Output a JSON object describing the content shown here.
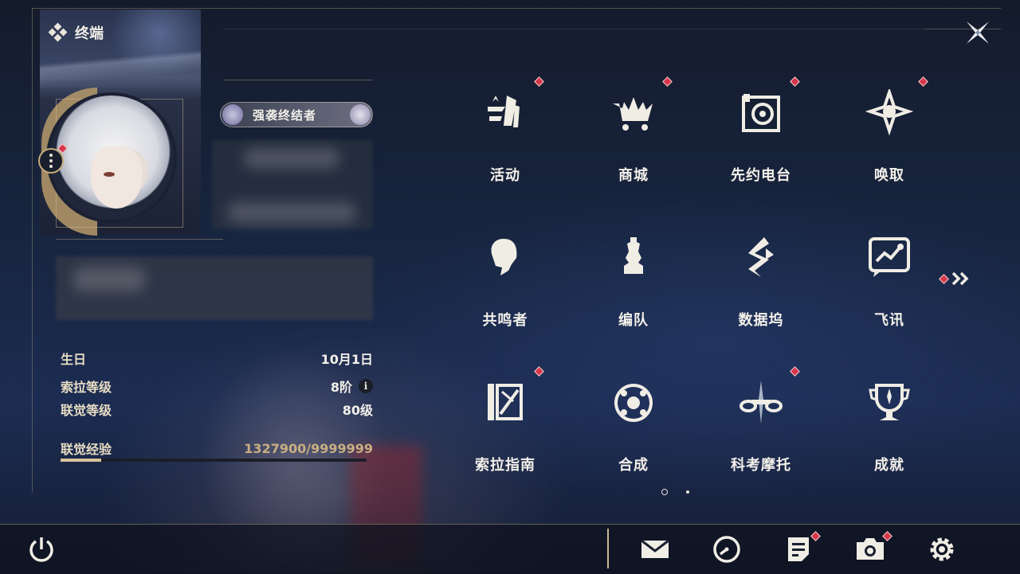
{
  "header": {
    "title": "终端"
  },
  "profile": {
    "title_badge": "强袭终结者",
    "stats": [
      {
        "label": "生日",
        "value": "10月1日"
      },
      {
        "label": "索拉等级",
        "value": "8阶"
      },
      {
        "label": "联觉等级",
        "value": "80级"
      }
    ],
    "exp": {
      "label": "联觉经验",
      "value": "1327900/9999999",
      "progress": 0.1328
    }
  },
  "menu": {
    "items": [
      {
        "label": "活动",
        "icon": "activity-icon",
        "badge": true
      },
      {
        "label": "商城",
        "icon": "shop-icon",
        "badge": true
      },
      {
        "label": "先约电台",
        "icon": "radio-icon",
        "badge": true
      },
      {
        "label": "唤取",
        "icon": "summon-icon",
        "badge": true
      },
      {
        "label": "共鸣者",
        "icon": "resonator-icon",
        "badge": false
      },
      {
        "label": "编队",
        "icon": "team-icon",
        "badge": false
      },
      {
        "label": "数据坞",
        "icon": "data-dock-icon",
        "badge": false
      },
      {
        "label": "飞讯",
        "icon": "message-icon",
        "badge": false
      },
      {
        "label": "索拉指南",
        "icon": "guide-icon",
        "badge": true
      },
      {
        "label": "合成",
        "icon": "synthesis-icon",
        "badge": false
      },
      {
        "label": "科考摩托",
        "icon": "motorcycle-icon",
        "badge": true
      },
      {
        "label": "成就",
        "icon": "achievement-icon",
        "badge": false
      }
    ]
  },
  "pagination": {
    "current": 1,
    "total": 2
  },
  "bottom_bar": {
    "icons": [
      "power-icon",
      "mail-icon",
      "clock-icon",
      "notice-icon",
      "camera-icon",
      "settings-icon"
    ]
  },
  "colors": {
    "accent": "#c9ae82",
    "badge": "#d8364a",
    "text": "#f3f0ea"
  }
}
